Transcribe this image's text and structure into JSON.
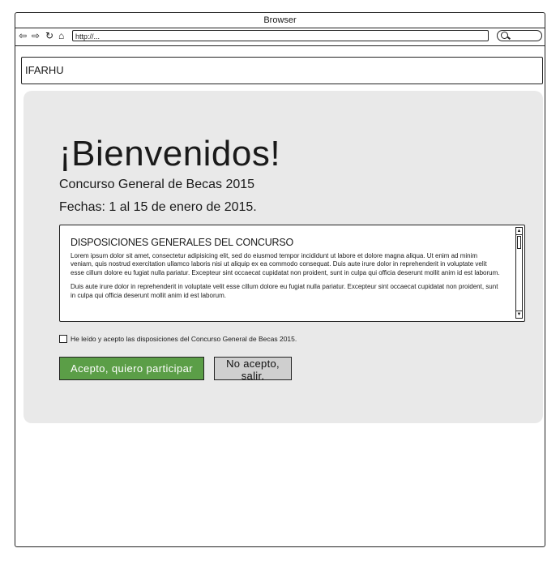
{
  "window": {
    "title": "Browser",
    "url": "http://..."
  },
  "nav": {
    "back_icon": "back-arrow-icon",
    "forward_icon": "forward-arrow-icon",
    "reload_icon": "reload-icon",
    "home_icon": "home-icon",
    "search_icon": "search-icon"
  },
  "header": {
    "brand": "IFARHU"
  },
  "main": {
    "welcome": "¡Bienvenidos!",
    "subtitle": "Concurso General de Becas 2015",
    "dates": "Fechas: 1 al 15 de enero de 2015.",
    "terms_title": "DISPOSICIONES GENERALES DEL CONCURSO",
    "terms_paragraph_1": "Lorem ipsum dolor sit amet, consectetur adipisicing elit, sed do eiusmod tempor incididunt ut labore et dolore magna aliqua. Ut enim ad minim veniam, quis nostrud exercitation ullamco laboris nisi ut aliquip ex ea commodo consequat. Duis aute irure dolor in reprehenderit in voluptate velit esse cillum dolore eu fugiat nulla pariatur. Excepteur sint occaecat cupidatat non proident, sunt in culpa qui officia deserunt mollit anim id est laborum.",
    "terms_paragraph_2": "Duis aute irure dolor in reprehenderit in voluptate velit esse cillum dolore eu fugiat nulla pariatur. Excepteur sint occaecat cupidatat non proident, sunt in culpa qui officia deserunt mollit anim id est laborum.",
    "checkbox_label": "He leído y acepto las disposiciones del Concurso General de Becas 2015.",
    "checkbox_checked": false,
    "accept_button": "Acepto, quiero participar",
    "decline_button": "No acepto, salir."
  },
  "colors": {
    "accept": "#5b9e47",
    "decline": "#cfcfcf",
    "panel": "#e9e9e9"
  }
}
